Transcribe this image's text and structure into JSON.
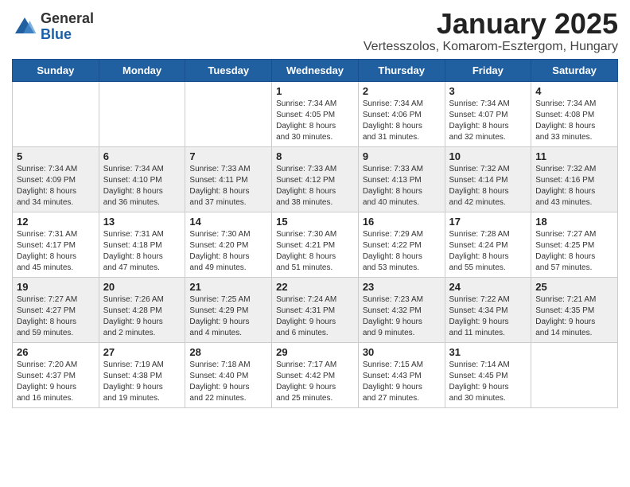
{
  "logo": {
    "general": "General",
    "blue": "Blue"
  },
  "title": {
    "month_year": "January 2025",
    "location": "Vertesszolos, Komarom-Esztergom, Hungary"
  },
  "days_of_week": [
    "Sunday",
    "Monday",
    "Tuesday",
    "Wednesday",
    "Thursday",
    "Friday",
    "Saturday"
  ],
  "weeks": [
    [
      {
        "day": "",
        "info": ""
      },
      {
        "day": "",
        "info": ""
      },
      {
        "day": "",
        "info": ""
      },
      {
        "day": "1",
        "info": "Sunrise: 7:34 AM\nSunset: 4:05 PM\nDaylight: 8 hours\nand 30 minutes."
      },
      {
        "day": "2",
        "info": "Sunrise: 7:34 AM\nSunset: 4:06 PM\nDaylight: 8 hours\nand 31 minutes."
      },
      {
        "day": "3",
        "info": "Sunrise: 7:34 AM\nSunset: 4:07 PM\nDaylight: 8 hours\nand 32 minutes."
      },
      {
        "day": "4",
        "info": "Sunrise: 7:34 AM\nSunset: 4:08 PM\nDaylight: 8 hours\nand 33 minutes."
      }
    ],
    [
      {
        "day": "5",
        "info": "Sunrise: 7:34 AM\nSunset: 4:09 PM\nDaylight: 8 hours\nand 34 minutes."
      },
      {
        "day": "6",
        "info": "Sunrise: 7:34 AM\nSunset: 4:10 PM\nDaylight: 8 hours\nand 36 minutes."
      },
      {
        "day": "7",
        "info": "Sunrise: 7:33 AM\nSunset: 4:11 PM\nDaylight: 8 hours\nand 37 minutes."
      },
      {
        "day": "8",
        "info": "Sunrise: 7:33 AM\nSunset: 4:12 PM\nDaylight: 8 hours\nand 38 minutes."
      },
      {
        "day": "9",
        "info": "Sunrise: 7:33 AM\nSunset: 4:13 PM\nDaylight: 8 hours\nand 40 minutes."
      },
      {
        "day": "10",
        "info": "Sunrise: 7:32 AM\nSunset: 4:14 PM\nDaylight: 8 hours\nand 42 minutes."
      },
      {
        "day": "11",
        "info": "Sunrise: 7:32 AM\nSunset: 4:16 PM\nDaylight: 8 hours\nand 43 minutes."
      }
    ],
    [
      {
        "day": "12",
        "info": "Sunrise: 7:31 AM\nSunset: 4:17 PM\nDaylight: 8 hours\nand 45 minutes."
      },
      {
        "day": "13",
        "info": "Sunrise: 7:31 AM\nSunset: 4:18 PM\nDaylight: 8 hours\nand 47 minutes."
      },
      {
        "day": "14",
        "info": "Sunrise: 7:30 AM\nSunset: 4:20 PM\nDaylight: 8 hours\nand 49 minutes."
      },
      {
        "day": "15",
        "info": "Sunrise: 7:30 AM\nSunset: 4:21 PM\nDaylight: 8 hours\nand 51 minutes."
      },
      {
        "day": "16",
        "info": "Sunrise: 7:29 AM\nSunset: 4:22 PM\nDaylight: 8 hours\nand 53 minutes."
      },
      {
        "day": "17",
        "info": "Sunrise: 7:28 AM\nSunset: 4:24 PM\nDaylight: 8 hours\nand 55 minutes."
      },
      {
        "day": "18",
        "info": "Sunrise: 7:27 AM\nSunset: 4:25 PM\nDaylight: 8 hours\nand 57 minutes."
      }
    ],
    [
      {
        "day": "19",
        "info": "Sunrise: 7:27 AM\nSunset: 4:27 PM\nDaylight: 8 hours\nand 59 minutes."
      },
      {
        "day": "20",
        "info": "Sunrise: 7:26 AM\nSunset: 4:28 PM\nDaylight: 9 hours\nand 2 minutes."
      },
      {
        "day": "21",
        "info": "Sunrise: 7:25 AM\nSunset: 4:29 PM\nDaylight: 9 hours\nand 4 minutes."
      },
      {
        "day": "22",
        "info": "Sunrise: 7:24 AM\nSunset: 4:31 PM\nDaylight: 9 hours\nand 6 minutes."
      },
      {
        "day": "23",
        "info": "Sunrise: 7:23 AM\nSunset: 4:32 PM\nDaylight: 9 hours\nand 9 minutes."
      },
      {
        "day": "24",
        "info": "Sunrise: 7:22 AM\nSunset: 4:34 PM\nDaylight: 9 hours\nand 11 minutes."
      },
      {
        "day": "25",
        "info": "Sunrise: 7:21 AM\nSunset: 4:35 PM\nDaylight: 9 hours\nand 14 minutes."
      }
    ],
    [
      {
        "day": "26",
        "info": "Sunrise: 7:20 AM\nSunset: 4:37 PM\nDaylight: 9 hours\nand 16 minutes."
      },
      {
        "day": "27",
        "info": "Sunrise: 7:19 AM\nSunset: 4:38 PM\nDaylight: 9 hours\nand 19 minutes."
      },
      {
        "day": "28",
        "info": "Sunrise: 7:18 AM\nSunset: 4:40 PM\nDaylight: 9 hours\nand 22 minutes."
      },
      {
        "day": "29",
        "info": "Sunrise: 7:17 AM\nSunset: 4:42 PM\nDaylight: 9 hours\nand 25 minutes."
      },
      {
        "day": "30",
        "info": "Sunrise: 7:15 AM\nSunset: 4:43 PM\nDaylight: 9 hours\nand 27 minutes."
      },
      {
        "day": "31",
        "info": "Sunrise: 7:14 AM\nSunset: 4:45 PM\nDaylight: 9 hours\nand 30 minutes."
      },
      {
        "day": "",
        "info": ""
      }
    ]
  ]
}
